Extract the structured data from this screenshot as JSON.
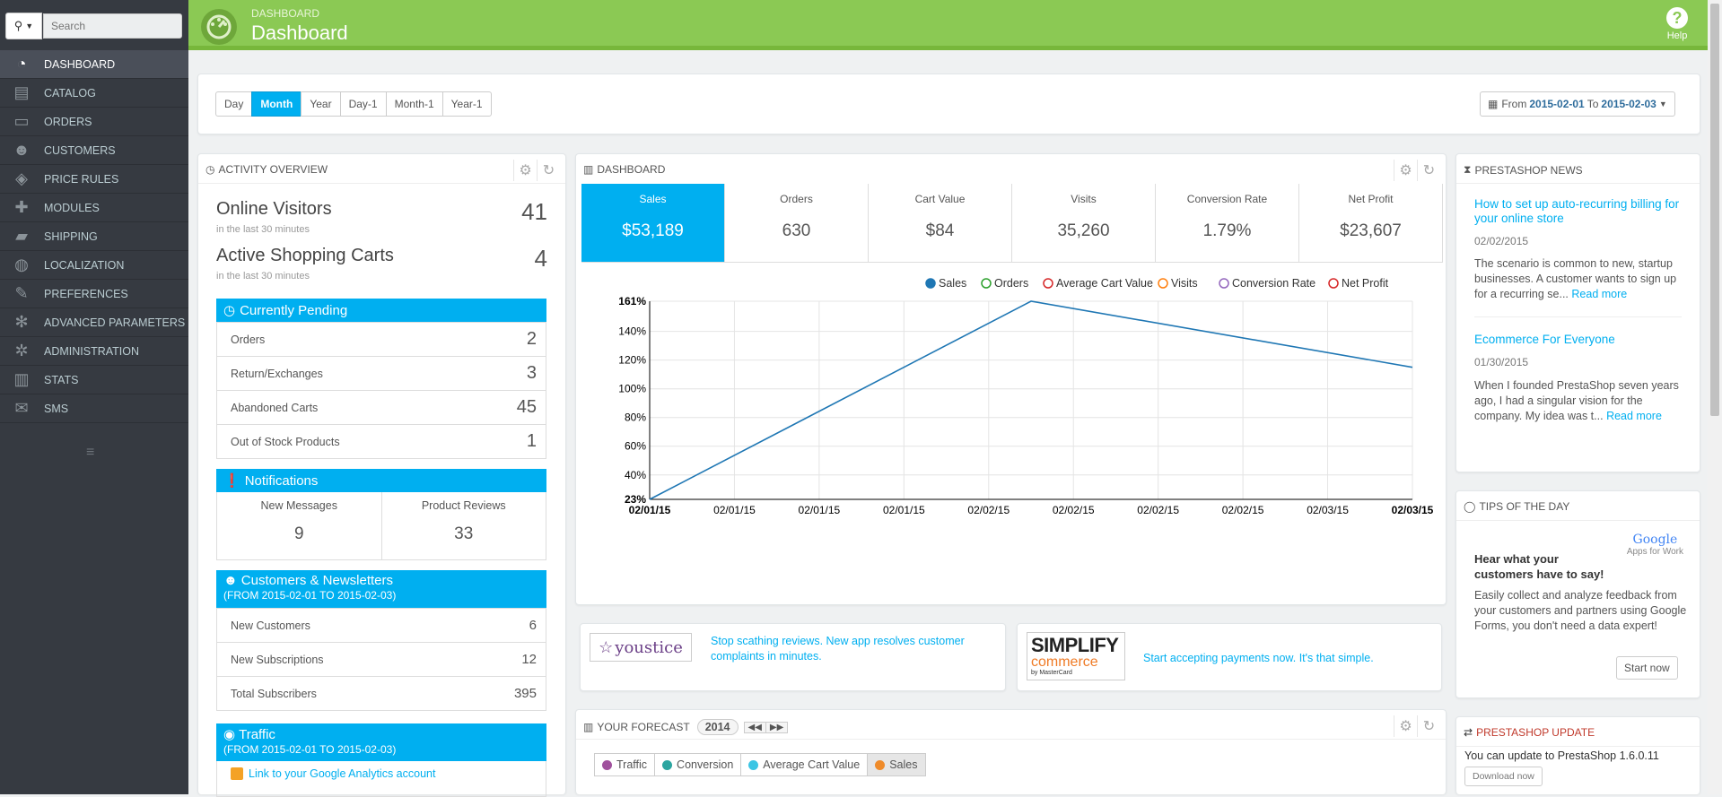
{
  "sidebar": {
    "search_placeholder": "Search",
    "items": [
      {
        "label": "DASHBOARD",
        "icon": "dashboard-icon",
        "glyph": "◔"
      },
      {
        "label": "CATALOG",
        "icon": "book-icon",
        "glyph": "▤"
      },
      {
        "label": "ORDERS",
        "icon": "credit-card-icon",
        "glyph": "▭"
      },
      {
        "label": "CUSTOMERS",
        "icon": "users-icon",
        "glyph": "☻"
      },
      {
        "label": "PRICE RULES",
        "icon": "tag-icon",
        "glyph": "◈"
      },
      {
        "label": "MODULES",
        "icon": "puzzle-icon",
        "glyph": "✚"
      },
      {
        "label": "SHIPPING",
        "icon": "truck-icon",
        "glyph": "▰"
      },
      {
        "label": "LOCALIZATION",
        "icon": "globe-icon",
        "glyph": "◍"
      },
      {
        "label": "PREFERENCES",
        "icon": "wrench-icon",
        "glyph": "✎"
      },
      {
        "label": "ADVANCED PARAMETERS",
        "icon": "cogs-icon",
        "glyph": "✻"
      },
      {
        "label": "ADMINISTRATION",
        "icon": "gear-icon",
        "glyph": "✲"
      },
      {
        "label": "STATS",
        "icon": "bar-chart-icon",
        "glyph": "▥"
      },
      {
        "label": "SMS",
        "icon": "envelope-icon",
        "glyph": "✉"
      }
    ]
  },
  "header": {
    "breadcrumb": "DASHBOARD",
    "title": "Dashboard",
    "help_label": "Help"
  },
  "periods": {
    "buttons": [
      "Day",
      "Month",
      "Year",
      "Day-1",
      "Month-1",
      "Year-1"
    ],
    "active": "Month",
    "date_from_prefix": "From",
    "date_from": "2015-02-01",
    "date_to_prefix": "To",
    "date_to": "2015-02-03"
  },
  "activity": {
    "title": "ACTIVITY OVERVIEW",
    "online_visitors_label": "Online Visitors",
    "online_visitors_sub": "in the last 30 minutes",
    "online_visitors_value": "41",
    "active_carts_label": "Active Shopping Carts",
    "active_carts_sub": "in the last 30 minutes",
    "active_carts_value": "4",
    "pending_title": "Currently Pending",
    "pending_rows": [
      {
        "label": "Orders",
        "value": "2"
      },
      {
        "label": "Return/Exchanges",
        "value": "3"
      },
      {
        "label": "Abandoned Carts",
        "value": "45"
      },
      {
        "label": "Out of Stock Products",
        "value": "1"
      }
    ],
    "notifications_title": "Notifications",
    "notifications": [
      {
        "label": "New Messages",
        "value": "9"
      },
      {
        "label": "Product Reviews",
        "value": "33"
      }
    ],
    "customers_title": "Customers & Newsletters",
    "customers_range": "(FROM 2015-02-01 TO 2015-02-03)",
    "customers_rows": [
      {
        "label": "New Customers",
        "value": "6"
      },
      {
        "label": "New Subscriptions",
        "value": "12"
      },
      {
        "label": "Total Subscribers",
        "value": "395"
      }
    ],
    "traffic_title": "Traffic",
    "traffic_range": "(FROM 2015-02-01 TO 2015-02-03)",
    "traffic_link": "Link to your Google Analytics account"
  },
  "dashboard": {
    "title": "DASHBOARD",
    "kpis": [
      {
        "label": "Sales",
        "value": "$53,189",
        "active": true
      },
      {
        "label": "Orders",
        "value": "630"
      },
      {
        "label": "Cart Value",
        "value": "$84"
      },
      {
        "label": "Visits",
        "value": "35,260"
      },
      {
        "label": "Conversion Rate",
        "value": "1.79%"
      },
      {
        "label": "Net Profit",
        "value": "$23,607"
      }
    ]
  },
  "chart_data": {
    "type": "line",
    "title": "",
    "xlabel": "",
    "ylabel": "",
    "legend_position": "top-right",
    "legend": [
      {
        "name": "Sales",
        "color": "#1f77b4",
        "filled": true
      },
      {
        "name": "Orders",
        "color": "#2ca02c",
        "filled": false
      },
      {
        "name": "Average Cart Value",
        "color": "#d62728",
        "filled": false
      },
      {
        "name": "Visits",
        "color": "#ff7f0e",
        "filled": false
      },
      {
        "name": "Conversion Rate",
        "color": "#9467bd",
        "filled": false
      },
      {
        "name": "Net Profit",
        "color": "#d62728",
        "filled": false
      }
    ],
    "x_ticks": [
      "02/01/15",
      "02/01/15",
      "02/01/15",
      "02/01/15",
      "02/02/15",
      "02/02/15",
      "02/02/15",
      "02/02/15",
      "02/03/15",
      "02/03/15"
    ],
    "y_ticks": [
      "23%",
      "40%",
      "60%",
      "80%",
      "100%",
      "120%",
      "140%",
      "161%"
    ],
    "ylim": [
      23,
      161
    ],
    "grid": true,
    "series": [
      {
        "name": "Sales",
        "color": "#1f77b4",
        "x": [
          0,
          1,
          2
        ],
        "values": [
          23,
          161,
          115
        ]
      }
    ]
  },
  "ads": {
    "youstice_logo": "youstice",
    "youstice_text": "Stop scathing reviews. New app resolves customer complaints in minutes.",
    "simplify_logo_top": "SIMPLIFY",
    "simplify_logo_mid": "commerce",
    "simplify_logo_bottom": "by MasterCard",
    "simplify_text": "Start accepting payments now. It's that simple."
  },
  "forecast": {
    "title": "YOUR FORECAST",
    "year": "2014",
    "tabs": [
      {
        "label": "Traffic",
        "color": "#a0519d"
      },
      {
        "label": "Conversion",
        "color": "#2ba5a0"
      },
      {
        "label": "Average Cart Value",
        "color": "#3bc5e4"
      },
      {
        "label": "Sales",
        "color": "#ef8b2a",
        "active": true
      }
    ]
  },
  "news": {
    "title": "PRESTASHOP NEWS",
    "items": [
      {
        "title": "How to set up auto-recurring billing for your online store",
        "date": "02/02/2015",
        "body": "The scenario is common to new, startup businesses. A customer wants to sign up for a recurring se...",
        "read_more": "Read more"
      },
      {
        "title": "Ecommerce For Everyone",
        "date": "01/30/2015",
        "body": "When I founded PrestaShop seven years ago, I had a singular vision for the company. My idea was t...",
        "read_more": "Read more"
      }
    ]
  },
  "tips": {
    "title": "TIPS OF THE DAY",
    "brand": "Google",
    "brand_sub": "Apps for Work",
    "heading": "Hear what your customers have to say!",
    "body": "Easily collect and analyze feedback from your customers and partners using Google Forms, you don't need a data expert!",
    "button": "Start now"
  },
  "update": {
    "title": "PRESTASHOP UPDATE",
    "text": "You can update to PrestaShop 1.6.0.11",
    "button": "Download now"
  }
}
